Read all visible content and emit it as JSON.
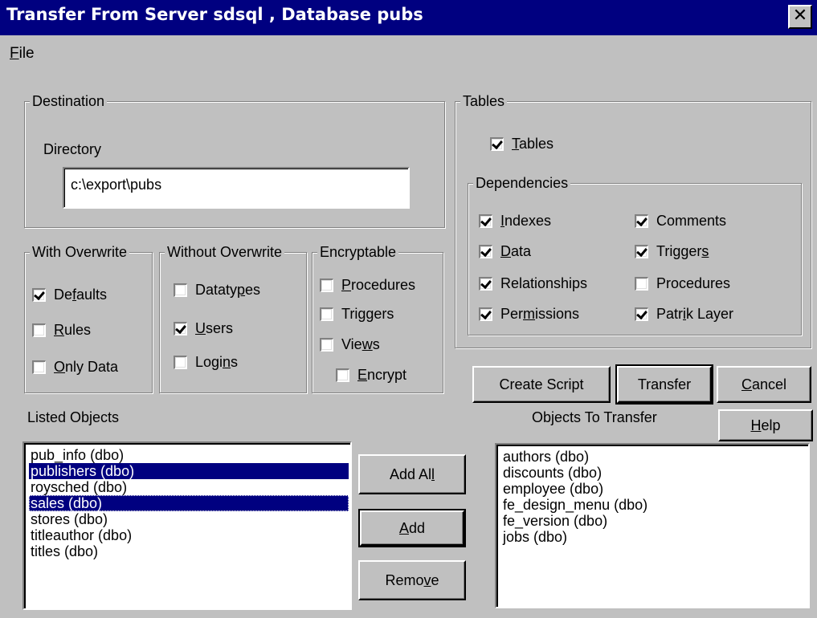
{
  "window": {
    "title": "Transfer From Server sdsql , Database pubs",
    "close_label": "✕"
  },
  "menu": {
    "file": "File"
  },
  "destination": {
    "legend": "Destination",
    "directory_label": "Directory",
    "directory_value": "c:\\export\\pubs"
  },
  "with_overwrite": {
    "legend": "With Overwrite",
    "items": [
      {
        "label": "Defaults",
        "checked": true
      },
      {
        "label": "Rules",
        "checked": false
      },
      {
        "label": "Only Data",
        "checked": false
      }
    ]
  },
  "without_overwrite": {
    "legend": "Without Overwrite",
    "items": [
      {
        "label": "Datatypes",
        "checked": false
      },
      {
        "label": "Users",
        "checked": true
      },
      {
        "label": "Logins",
        "checked": false
      }
    ]
  },
  "encryptable": {
    "legend": "Encryptable",
    "items": [
      {
        "label": "Procedures",
        "checked": false
      },
      {
        "label": "Triggers",
        "checked": false
      },
      {
        "label": "Views",
        "checked": false
      },
      {
        "label": "Encrypt",
        "checked": false
      }
    ]
  },
  "tables": {
    "legend": "Tables",
    "tables_checkbox": {
      "label": "Tables",
      "checked": true
    },
    "dependencies": {
      "legend": "Dependencies",
      "items": [
        {
          "label": "Indexes",
          "checked": true
        },
        {
          "label": "Comments",
          "checked": true
        },
        {
          "label": "Data",
          "checked": true
        },
        {
          "label": "Triggers",
          "checked": true
        },
        {
          "label": "Relationships",
          "checked": true
        },
        {
          "label": "Procedures",
          "checked": false
        },
        {
          "label": "Permissions",
          "checked": true
        },
        {
          "label": "Patrik Layer",
          "checked": true
        }
      ]
    }
  },
  "buttons": {
    "create_script": "Create Script",
    "transfer": "Transfer",
    "cancel": "Cancel",
    "help": "Help",
    "add_all": "Add All",
    "add": "Add",
    "remove": "Remove"
  },
  "listed_objects": {
    "label": "Listed Objects",
    "items": [
      {
        "text": "pub_info (dbo)",
        "selected": false
      },
      {
        "text": "publishers (dbo)",
        "selected": true
      },
      {
        "text": "roysched (dbo)",
        "selected": false
      },
      {
        "text": "sales (dbo)",
        "selected": true
      },
      {
        "text": "stores (dbo)",
        "selected": false
      },
      {
        "text": "titleauthor (dbo)",
        "selected": false
      },
      {
        "text": "titles (dbo)",
        "selected": false
      }
    ]
  },
  "objects_to_transfer": {
    "label": "Objects To Transfer",
    "items": [
      "authors (dbo)",
      "discounts (dbo)",
      "employee (dbo)",
      "fe_design_menu (dbo)",
      "fe_version (dbo)",
      "jobs (dbo)"
    ]
  }
}
